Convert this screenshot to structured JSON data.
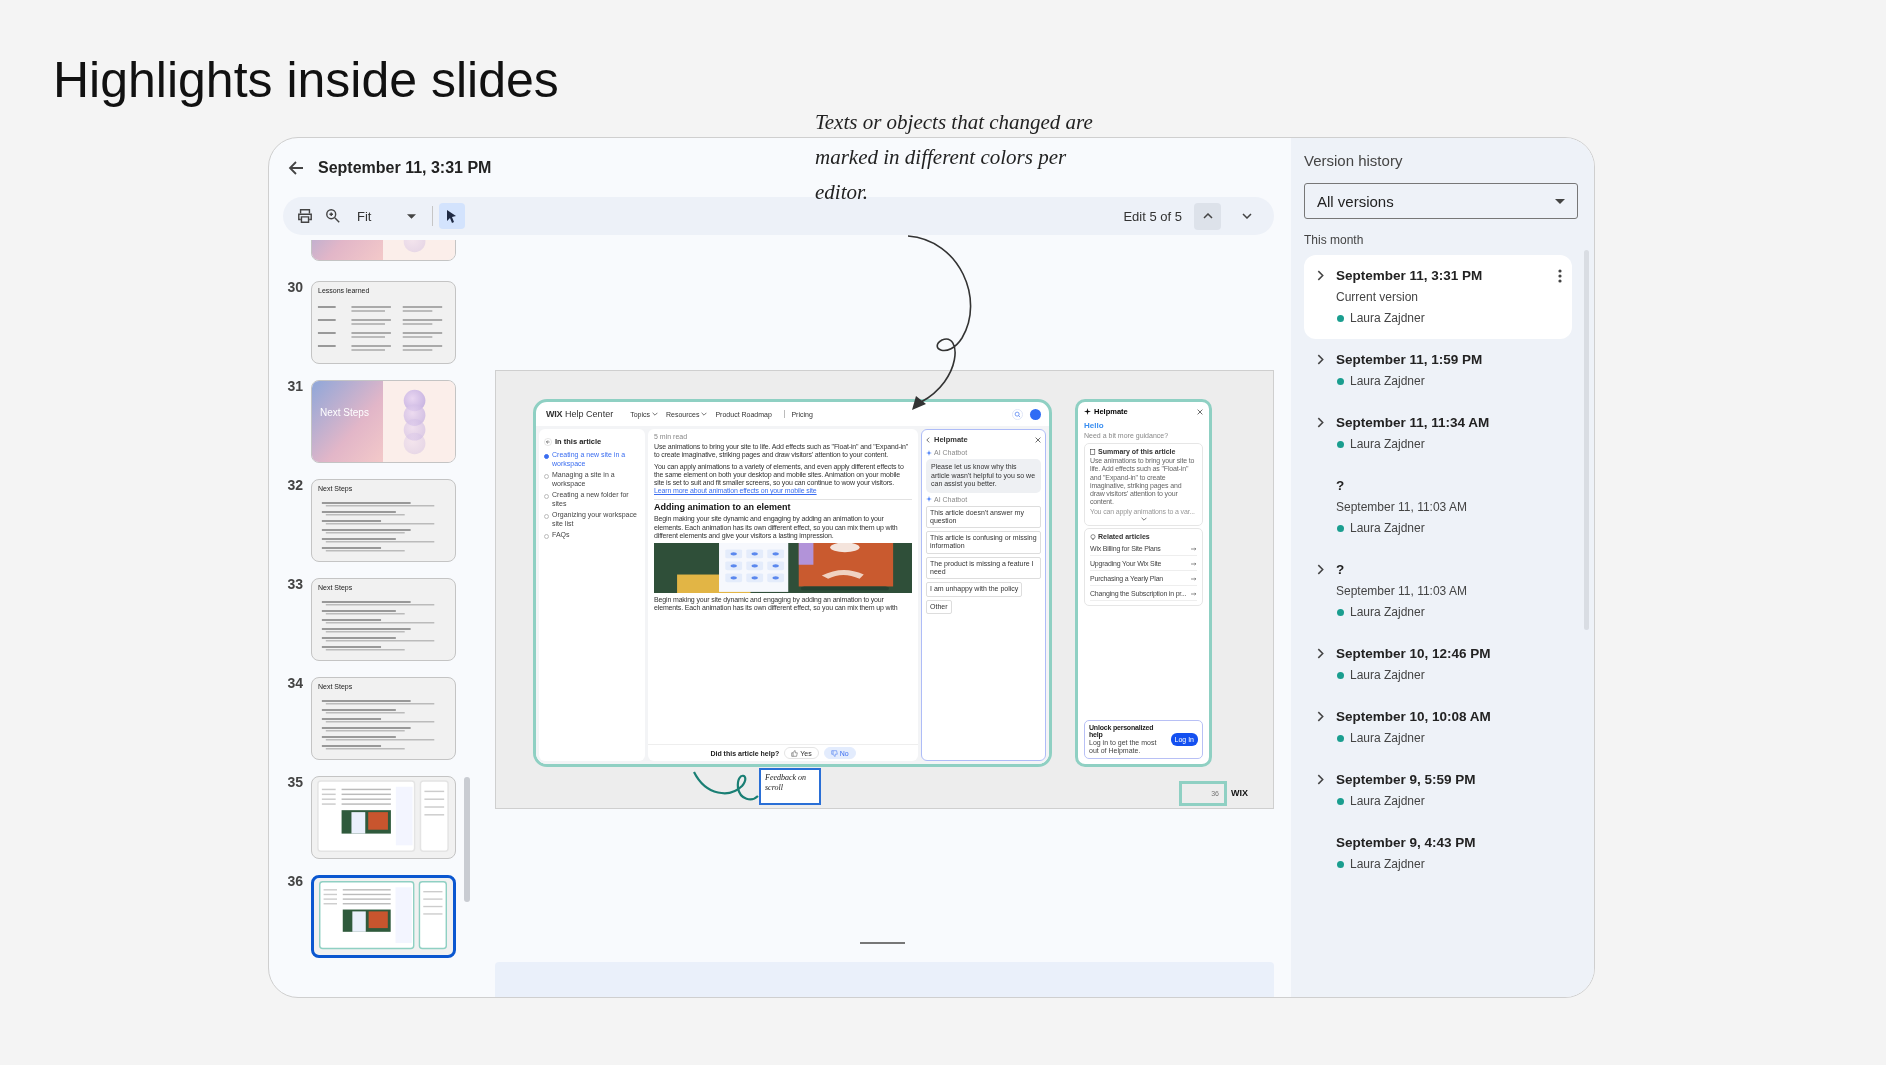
{
  "slide_title": "Highlights inside slides",
  "header": {
    "title": "September 11, 3:31 PM"
  },
  "toolbar": {
    "zoom": "Fit",
    "pointer_selected": true,
    "edit_counter": "Edit 5 of 5"
  },
  "annotation": "Texts or objects that changed are marked in different colors per editor.",
  "thumbnails": [
    {
      "kind": "cover",
      "cut": true,
      "selected": false
    },
    {
      "number": "30",
      "kind": "table",
      "title": "Lessons learned",
      "cut": false,
      "selected": false
    },
    {
      "number": "31",
      "kind": "cover",
      "title": "Next Steps",
      "cut": false,
      "selected": false
    },
    {
      "number": "32",
      "kind": "list",
      "title": "Next Steps",
      "cut": false,
      "selected": false
    },
    {
      "number": "33",
      "kind": "list",
      "title": "Next Steps",
      "cut": false,
      "selected": false
    },
    {
      "number": "34",
      "kind": "list",
      "title": "Next Steps",
      "cut": false,
      "selected": false
    },
    {
      "number": "35",
      "kind": "screenshot",
      "cut": false,
      "selected": false
    },
    {
      "number": "36",
      "kind": "screenshot",
      "cut": false,
      "selected": true
    }
  ],
  "slide": {
    "site": {
      "logo": "WIX",
      "title": "Help Center",
      "nav": [
        {
          "label": "Topics",
          "dropdown": true
        },
        {
          "label": "Resources",
          "dropdown": true
        },
        {
          "label": "Product Roadmap",
          "dropdown": false
        },
        {
          "label": "Pricing",
          "dropdown": false
        }
      ]
    },
    "toc": {
      "title": "In this article",
      "items": [
        {
          "label": "Creating a new site in a workspace",
          "selected": true
        },
        {
          "label": "Managing a site in a workspace",
          "selected": false
        },
        {
          "label": "Creating a new folder for sites",
          "selected": false
        },
        {
          "label": "Organizing your workspace site list",
          "selected": false
        },
        {
          "label": "FAQs",
          "selected": false
        }
      ]
    },
    "article": {
      "read_time": "5 min read",
      "intro": "Use animations to bring your site to life. Add effects such as \"Float-in\" and \"Expand-in\" to create imaginative, striking pages and draw visitors' attention to your content.",
      "paragraph": "You can apply animations to a variety of elements, and even apply different effects to the same element on both your desktop and mobile sites. Animation on your mobile site is set to suit and fit smaller screens, so you can continue to wow your visitors.",
      "link": "Learn more about animation effects on your mobile site",
      "heading": "Adding animation to an element",
      "body": "Begin making your site dynamic and engaging by adding an animation to your elements. Each animation has its own different effect, so you can mix them up with different elements and give your visitors a lasting impression.",
      "body_2": "Begin making your site dynamic and engaging by adding an animation to your elements. Each animation has its own different effect, so you can mix them up with",
      "feedback": {
        "question": "Did this article help?",
        "yes": "Yes",
        "no": "No"
      }
    },
    "chat": {
      "title": "Helpmate",
      "sender": "AI Chatbot",
      "message": "Please let us know why this article wasn't helpful to you so we can assist you better.",
      "sender_2": "AI Chatbot",
      "options": [
        "This article doesn't answer my question",
        "This article is confusing or missing information",
        "The product is missing a feature I need",
        "I am unhappy with the policy",
        "Other"
      ]
    },
    "helpmate": {
      "title": "Helpmate",
      "greeting": "Hello",
      "subtitle": "Need a bit more guidance?",
      "summary_title": "Summary of this article",
      "summary": "Use animations to bring your site to life. Add effects such as \"Float-in\" and \"Expand-in\" to create imaginative, striking pages and draw visitors' attention to your content.",
      "summary_more": "You can apply animations to a var...",
      "related_title": "Related articles",
      "related": [
        "Wix Billing for Site Plans",
        "Upgrading Your Wix Site",
        "Purchasing a Yearly Plan",
        "Changing the Subscription in pr..."
      ],
      "promo_title": "Unlock personalized help",
      "promo_text": "Log in to get the most out of Helpmate.",
      "promo_button": "Log In"
    },
    "feedback_note": "Feedback on scroll",
    "page_number": "36",
    "brand": "WIX"
  },
  "version_history": {
    "title": "Version history",
    "filter": "All versions",
    "group": "This month",
    "versions": [
      {
        "title": "September 11, 3:31 PM",
        "subtitle": "Current version",
        "author": "Laura Zajdner",
        "color": "#1a9e8f",
        "expandable": true,
        "selected": true
      },
      {
        "title": "September 11, 1:59 PM",
        "author": "Laura Zajdner",
        "color": "#1a9e8f",
        "expandable": true,
        "selected": false
      },
      {
        "title": "September 11, 11:34 AM",
        "author": "Laura Zajdner",
        "color": "#1a9e8f",
        "expandable": true,
        "selected": false
      },
      {
        "title": "?",
        "subtitle": "September 11, 11:03 AM",
        "author": "Laura Zajdner",
        "color": "#1a9e8f",
        "expandable": false,
        "selected": false
      },
      {
        "title": "?",
        "subtitle": "September 11, 11:03 AM",
        "author": "Laura Zajdner",
        "color": "#1a9e8f",
        "expandable": true,
        "selected": false
      },
      {
        "title": "September 10, 12:46 PM",
        "author": "Laura Zajdner",
        "color": "#1a9e8f",
        "expandable": true,
        "selected": false
      },
      {
        "title": "September 10, 10:08 AM",
        "author": "Laura Zajdner",
        "color": "#1a9e8f",
        "expandable": true,
        "selected": false
      },
      {
        "title": "September 9, 5:59 PM",
        "author": "Laura Zajdner",
        "color": "#1a9e8f",
        "expandable": true,
        "selected": false
      },
      {
        "title": "September 9, 4:43 PM",
        "author": "Laura Zajdner",
        "color": "#1a9e8f",
        "expandable": false,
        "selected": false
      }
    ]
  }
}
